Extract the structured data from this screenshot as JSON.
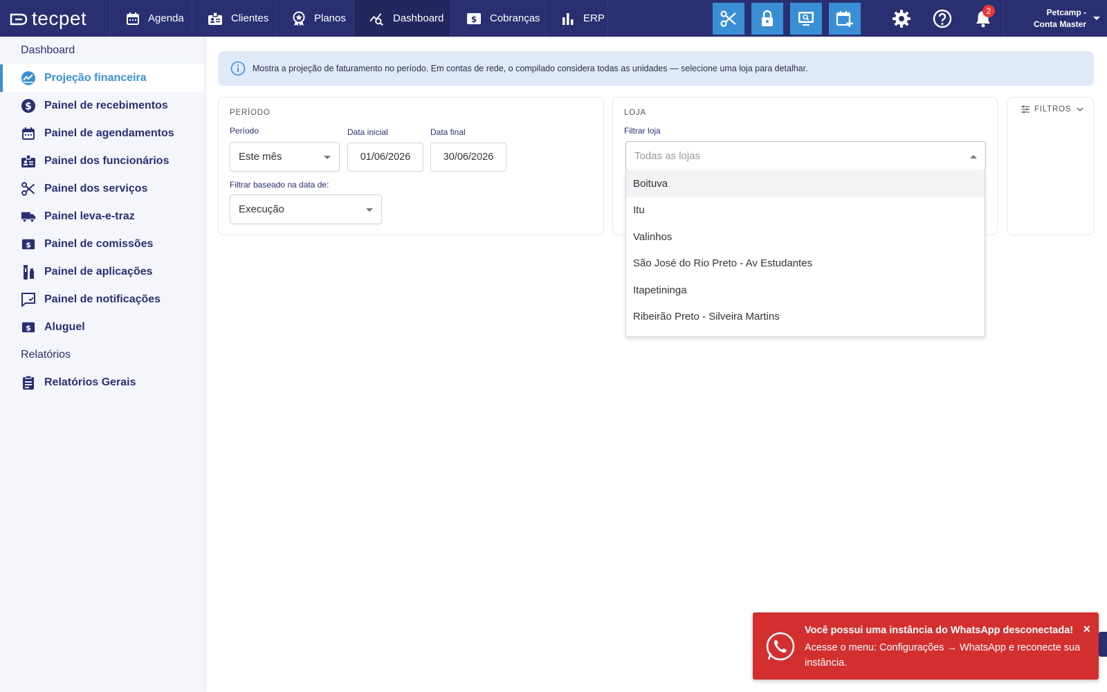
{
  "app": {
    "logo_text": "tecpet"
  },
  "topnav": {
    "items": [
      {
        "label": "Agenda",
        "icon": "calendar-icon"
      },
      {
        "label": "Clientes",
        "icon": "id-badge-icon"
      },
      {
        "label": "Planos",
        "icon": "award-icon"
      },
      {
        "label": "Dashboard",
        "icon": "chart-search-icon"
      },
      {
        "label": "Cobranças",
        "icon": "dollar-note-icon"
      },
      {
        "label": "ERP",
        "icon": "bar-chart-icon"
      }
    ],
    "active": "Dashboard",
    "tools": [
      "scissors-icon",
      "lock-icon",
      "monitor-search-icon",
      "calendar-plus-icon"
    ],
    "tool_color": "#3a8fd4",
    "notifications_count": "2",
    "user_name": "Petcamp - Conta Master"
  },
  "sidebar": {
    "section_dashboard": "Dashboard",
    "items": [
      {
        "label": "Projeção financeira",
        "icon": "trend-chart-icon"
      },
      {
        "label": "Painel de recebimentos",
        "icon": "dollar-circle-icon"
      },
      {
        "label": "Painel de agendamentos",
        "icon": "calendar-icon"
      },
      {
        "label": "Painel dos funcionários",
        "icon": "id-badge-icon"
      },
      {
        "label": "Painel dos serviços",
        "icon": "scissors-icon"
      },
      {
        "label": "Painel leva-e-traz",
        "icon": "truck-icon"
      },
      {
        "label": "Painel de comissões",
        "icon": "dollar-note-icon"
      },
      {
        "label": "Painel de aplicações",
        "icon": "vaccine-icon"
      },
      {
        "label": "Painel de notificações",
        "icon": "chat-check-icon"
      },
      {
        "label": "Aluguel",
        "icon": "dollar-note-icon"
      }
    ],
    "section_relatorios": "Relatórios",
    "report_item": {
      "label": "Relatórios Gerais",
      "icon": "clipboard-icon"
    },
    "active": "Projeção financeira"
  },
  "info_banner": {
    "text": "Mostra a projeção de faturamento no período. Em contas de rede, o compilado considera todas as unidades — selecione uma loja para detalhar."
  },
  "periodo_card": {
    "title": "PERÍODO",
    "periodo_label": "Período",
    "periodo_value": "Este mês",
    "data_inicial_label": "Data inicial",
    "data_inicial_value": "01/06/2026",
    "data_final_label": "Data final",
    "data_final_value": "30/06/2026",
    "filtrar_label": "Filtrar baseado na data de:",
    "filtrar_value": "Execução"
  },
  "loja_card": {
    "title": "LOJA",
    "filtrar_label": "Filtrar loja",
    "placeholder": "Todas as lojas",
    "options": [
      "Boituva",
      "Itu",
      "Valinhos",
      "São José do Rio Preto - Av Estudantes",
      "Itapetininga",
      "Ribeirão Preto - Silveira Martins"
    ],
    "hovered": "Boituva"
  },
  "filtros": {
    "label": "FILTROS"
  },
  "toast": {
    "title": "Você possui uma instância do WhatsApp desconectada!",
    "body": "Acesse o menu: Configurações → WhatsApp e reconecte sua instância.",
    "close": "×",
    "color": "#d32f2f"
  },
  "colors": {
    "nav_bg": "#2a2f72",
    "accent": "#3a8fd4",
    "sidebar_bg": "#f4f6fb",
    "banner_bg": "#dfe9f7"
  }
}
